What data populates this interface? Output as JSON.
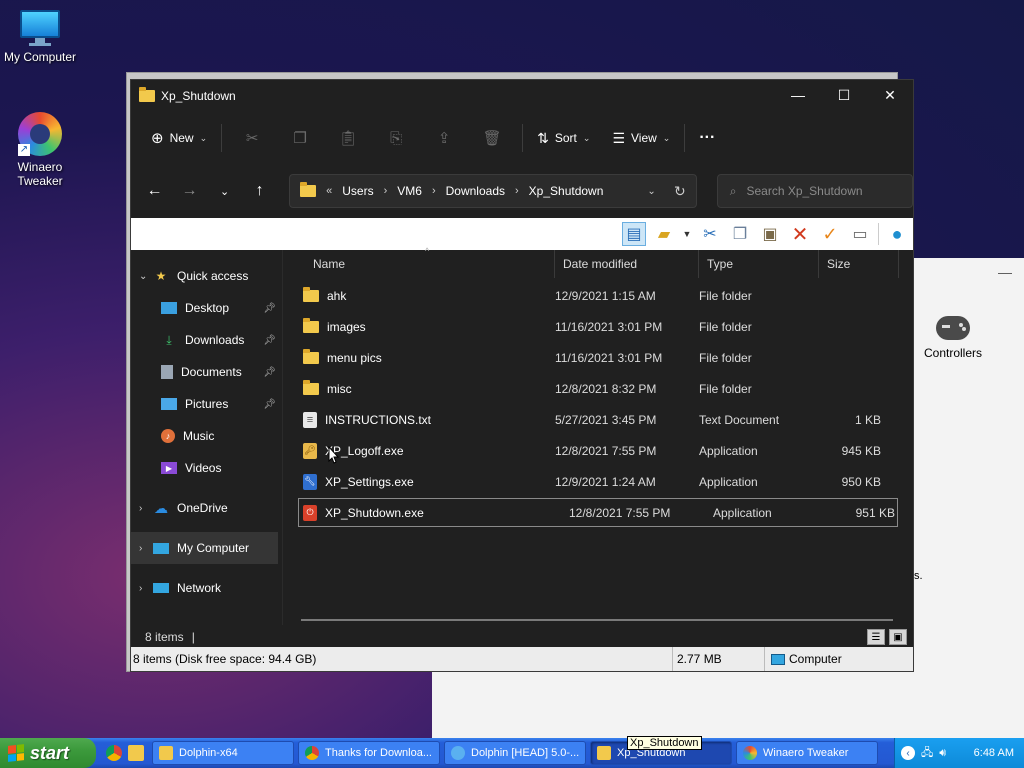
{
  "desktop": {
    "icons": [
      {
        "label": "My Computer",
        "icon": "computer-icon"
      },
      {
        "label": "Winaero\nTweaker",
        "icon": "winaero-tweaker-icon"
      }
    ]
  },
  "bg_window": {
    "controllers_label": "Controllers",
    "fragment_text": "s."
  },
  "explorer": {
    "title": "Xp_Shutdown",
    "toolbar": {
      "new_label": "New",
      "sort_label": "Sort",
      "view_label": "View",
      "more_label": "···"
    },
    "address": {
      "overflow": "«",
      "crumbs": [
        "Users",
        "VM6",
        "Downloads",
        "Xp_Shutdown"
      ]
    },
    "search_placeholder": "Search Xp_Shutdown",
    "nav": {
      "quick_access": "Quick access",
      "items": [
        {
          "label": "Desktop",
          "pinned": true
        },
        {
          "label": "Downloads",
          "pinned": true
        },
        {
          "label": "Documents",
          "pinned": true
        },
        {
          "label": "Pictures",
          "pinned": true
        },
        {
          "label": "Music",
          "pinned": false
        },
        {
          "label": "Videos",
          "pinned": false
        }
      ],
      "onedrive": "OneDrive",
      "mycomputer": "My Computer",
      "network": "Network"
    },
    "columns": [
      "Name",
      "Date modified",
      "Type",
      "Size"
    ],
    "files": [
      {
        "name": "ahk",
        "date": "12/9/2021 1:15 AM",
        "type": "File folder",
        "size": "",
        "kind": "folder"
      },
      {
        "name": "images",
        "date": "11/16/2021 3:01 PM",
        "type": "File folder",
        "size": "",
        "kind": "folder"
      },
      {
        "name": "menu pics",
        "date": "11/16/2021 3:01 PM",
        "type": "File folder",
        "size": "",
        "kind": "folder"
      },
      {
        "name": "misc",
        "date": "12/8/2021 8:32 PM",
        "type": "File folder",
        "size": "",
        "kind": "folder"
      },
      {
        "name": "INSTRUCTIONS.txt",
        "date": "5/27/2021 3:45 PM",
        "type": "Text Document",
        "size": "1 KB",
        "kind": "text"
      },
      {
        "name": "XP_Logoff.exe",
        "date": "12/8/2021 7:55 PM",
        "type": "Application",
        "size": "945 KB",
        "kind": "app-logoff"
      },
      {
        "name": "XP_Settings.exe",
        "date": "12/9/2021 1:24 AM",
        "type": "Application",
        "size": "950 KB",
        "kind": "app-settings"
      },
      {
        "name": "XP_Shutdown.exe",
        "date": "12/8/2021 7:55 PM",
        "type": "Application",
        "size": "951 KB",
        "kind": "app-shutdown"
      }
    ],
    "status_items": "8 items",
    "classic_status": {
      "left": "8 items (Disk free space: 94.4 GB)",
      "middle": "2.77 MB",
      "right": "Computer"
    }
  },
  "taskbar": {
    "start_label": "start",
    "tasks": [
      {
        "label": "Dolphin-x64",
        "icon": "folder-icon",
        "active": false
      },
      {
        "label": "Thanks for Downloa...",
        "icon": "chrome-icon",
        "active": false
      },
      {
        "label": "Dolphin [HEAD] 5.0-...",
        "icon": "dolphin-icon",
        "active": false
      },
      {
        "label": "Xp_Shutdown",
        "icon": "folder-icon",
        "active": true
      },
      {
        "label": "Winaero Tweaker",
        "icon": "winaero-icon",
        "active": false
      }
    ],
    "clock": "6:48 AM",
    "tooltip": "Xp_Shutdown"
  },
  "colors": {
    "explorer_bg": "#202020",
    "taskbar_blue": "#245ed8",
    "start_green": "#3c9a3c",
    "folder_yellow": "#f2c94c"
  }
}
